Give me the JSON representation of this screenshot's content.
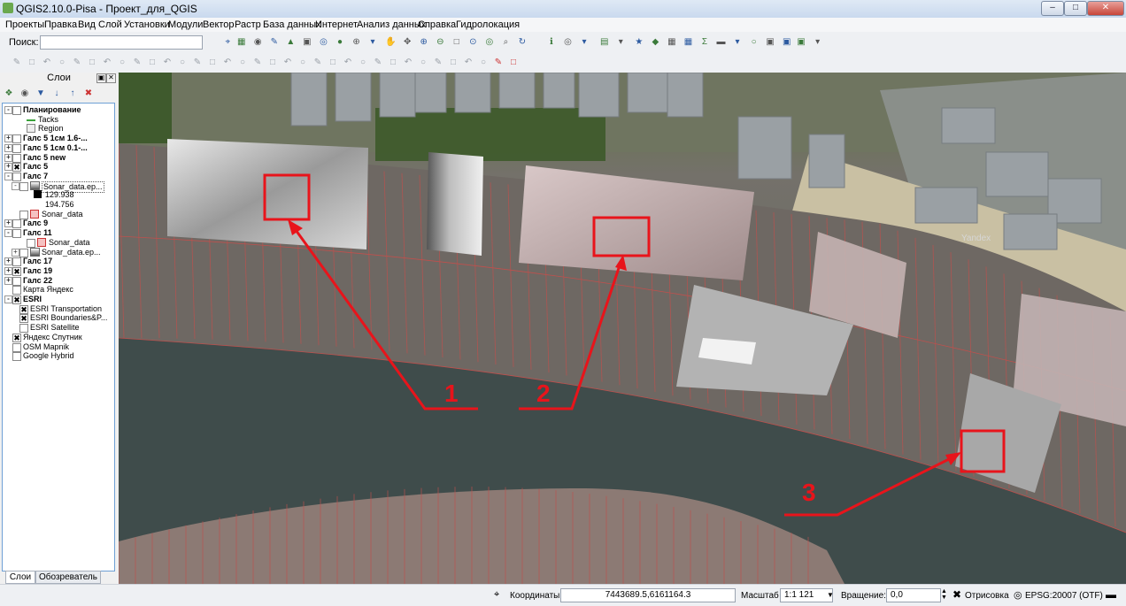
{
  "window": {
    "title": "QGIS2.10.0-Pisa - Проект_для_QGIS"
  },
  "menu": [
    "Проекты",
    "Правка",
    "Вид",
    "Слой",
    "Установки",
    "Модули",
    "Вектор",
    "Растр",
    "База данных",
    "Интернет",
    "Анализ данных",
    "Справка",
    "Гидролокация"
  ],
  "search": {
    "label": "Поиск:",
    "value": ""
  },
  "layers_panel": {
    "title": "Слои",
    "tabs": [
      "Слои",
      "Обозреватель"
    ],
    "items": [
      {
        "label": "Планирование",
        "bold": true,
        "checked": false,
        "expander": "-",
        "indent": 0
      },
      {
        "label": "Tacks",
        "bold": false,
        "indent": 2,
        "symbol": "line-green"
      },
      {
        "label": "Region",
        "bold": false,
        "indent": 2,
        "symbol": "poly-gray"
      },
      {
        "label": "Галс 5 1см 1.6-...",
        "bold": true,
        "checked": false,
        "expander": "+",
        "indent": 0
      },
      {
        "label": "Галс 5 1см 0.1-...",
        "bold": true,
        "checked": false,
        "expander": "+",
        "indent": 0
      },
      {
        "label": "Галс 5 new",
        "bold": true,
        "checked": false,
        "expander": "+",
        "indent": 0
      },
      {
        "label": "Галс 5",
        "bold": true,
        "checked": true,
        "expander": "+",
        "indent": 0
      },
      {
        "label": "Галс 7",
        "bold": true,
        "checked": false,
        "expander": "-",
        "indent": 0
      },
      {
        "label": "Sonar_data.ep...",
        "bold": false,
        "checked": false,
        "expander": "-",
        "indent": 1,
        "symbol": "raster"
      },
      {
        "label": "129.938",
        "bold": false,
        "indent": 3,
        "symbol": "swatch-black"
      },
      {
        "label": "194.756",
        "bold": false,
        "indent": 3,
        "symbol": "none"
      },
      {
        "label": "Sonar_data",
        "bold": false,
        "checked": false,
        "indent": 1,
        "symbol": "poly-red"
      },
      {
        "label": "Галс 9",
        "bold": true,
        "checked": false,
        "expander": "+",
        "indent": 0
      },
      {
        "label": "Галс 11",
        "bold": true,
        "checked": false,
        "expander": "-",
        "indent": 0
      },
      {
        "label": "Sonar_data",
        "bold": false,
        "checked": false,
        "indent": 2,
        "symbol": "poly-red"
      },
      {
        "label": "Sonar_data.ep...",
        "bold": false,
        "checked": false,
        "expander": "+",
        "indent": 1,
        "symbol": "raster"
      },
      {
        "label": "Галс 17",
        "bold": true,
        "checked": false,
        "expander": "+",
        "indent": 0
      },
      {
        "label": "Галс 19",
        "bold": true,
        "checked": true,
        "expander": "+",
        "indent": 0
      },
      {
        "label": "Галс 22",
        "bold": true,
        "checked": false,
        "expander": "+",
        "indent": 0
      },
      {
        "label": "Карта Яндекс",
        "bold": false,
        "checked": false,
        "indent": 0
      },
      {
        "label": "ESRI",
        "bold": true,
        "checked": true,
        "expander": "-",
        "indent": 0
      },
      {
        "label": "ESRI Transportation",
        "bold": false,
        "checked": true,
        "indent": 1
      },
      {
        "label": "ESRI Boundaries&P...",
        "bold": false,
        "checked": true,
        "indent": 1
      },
      {
        "label": "ESRI Satellite",
        "bold": false,
        "checked": false,
        "indent": 1
      },
      {
        "label": "Яндекс Спутник",
        "bold": false,
        "checked": true,
        "indent": 0
      },
      {
        "label": "OSM Mapnik",
        "bold": false,
        "checked": false,
        "indent": 0
      },
      {
        "label": "Google Hybrid",
        "bold": false,
        "checked": false,
        "indent": 0
      }
    ]
  },
  "map": {
    "annotations": [
      "1",
      "2",
      "3"
    ],
    "watermark": "Yandex",
    "accent_color": "#e8141b"
  },
  "statusbar": {
    "coords_label": "Координаты:",
    "coords_value": "7443689.5,6161164.3",
    "scale_label": "Масштаб",
    "scale_value": "1:1 121",
    "rotation_label": "Вращение:",
    "rotation_value": "0,0",
    "render_label": "Отрисовка",
    "crs_label": "EPSG:20007 (OTF)"
  }
}
